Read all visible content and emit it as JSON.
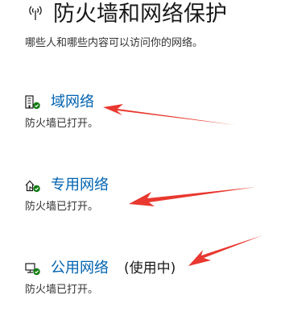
{
  "header": {
    "title": "防火墙和网络保护",
    "description": "哪些人和哪些内容可以访问你的网络。",
    "icon": "wifi-antenna-icon"
  },
  "networks": [
    {
      "name": "域网络",
      "status": "防火墙已打开。",
      "icon": "domain-building-icon",
      "in_use": ""
    },
    {
      "name": "专用网络",
      "status": "防火墙已打开。",
      "icon": "private-home-icon",
      "in_use": ""
    },
    {
      "name": "公用网络",
      "status": "防火墙已打开。",
      "icon": "public-monitor-icon",
      "in_use": "(使用中)"
    }
  ],
  "colors": {
    "link": "#0063b1",
    "check": "#107c10",
    "annotation_arrow": "#e8382f"
  }
}
